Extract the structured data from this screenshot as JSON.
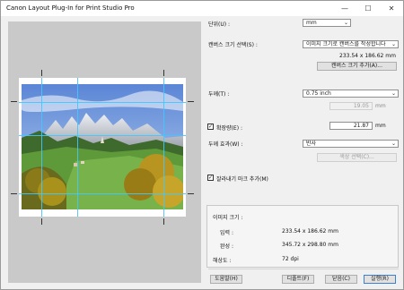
{
  "window": {
    "title": "Canon Layout Plug-In for Print Studio Pro",
    "minimize": "—",
    "maximize": "☐",
    "close": "✕"
  },
  "settings": {
    "unit_label": "단위(U) :",
    "unit_value": "mm",
    "canvas_label": "캔버스 크기 선택(S) :",
    "canvas_value": "이미지 크기로 캔버스를 작성합니다",
    "canvas_size_text": "233.54 x 186.62 mm",
    "canvas_add_button": "캔버스 크기 추가(A)...",
    "border_label": "두께(T) :",
    "border_value": "0.75 inch",
    "border_mm_value": "19.05",
    "border_mm_unit": "mm",
    "expand_label": "확장량(E) :",
    "expand_value": "21.87",
    "expand_unit": "mm",
    "border_effect_label": "두께 효과(W) :",
    "border_effect_value": "반사",
    "color_select_button": "색상 선택(C)...",
    "cut_marks_label": "잘라내기 마크 추가(M)"
  },
  "info": {
    "title": "이미지 크기 :",
    "input_label": "입력 :",
    "input_value": "233.54 x 186.62 mm",
    "output_label": "완성 :",
    "output_value": "345.72 x 298.80 mm",
    "resolution_label": "해상도 :",
    "resolution_value": "72 dpi"
  },
  "footer": {
    "help": "도움말(H)",
    "defaults": "디폴트(F)",
    "close": "닫음(C)",
    "execute": "실행(R)"
  }
}
